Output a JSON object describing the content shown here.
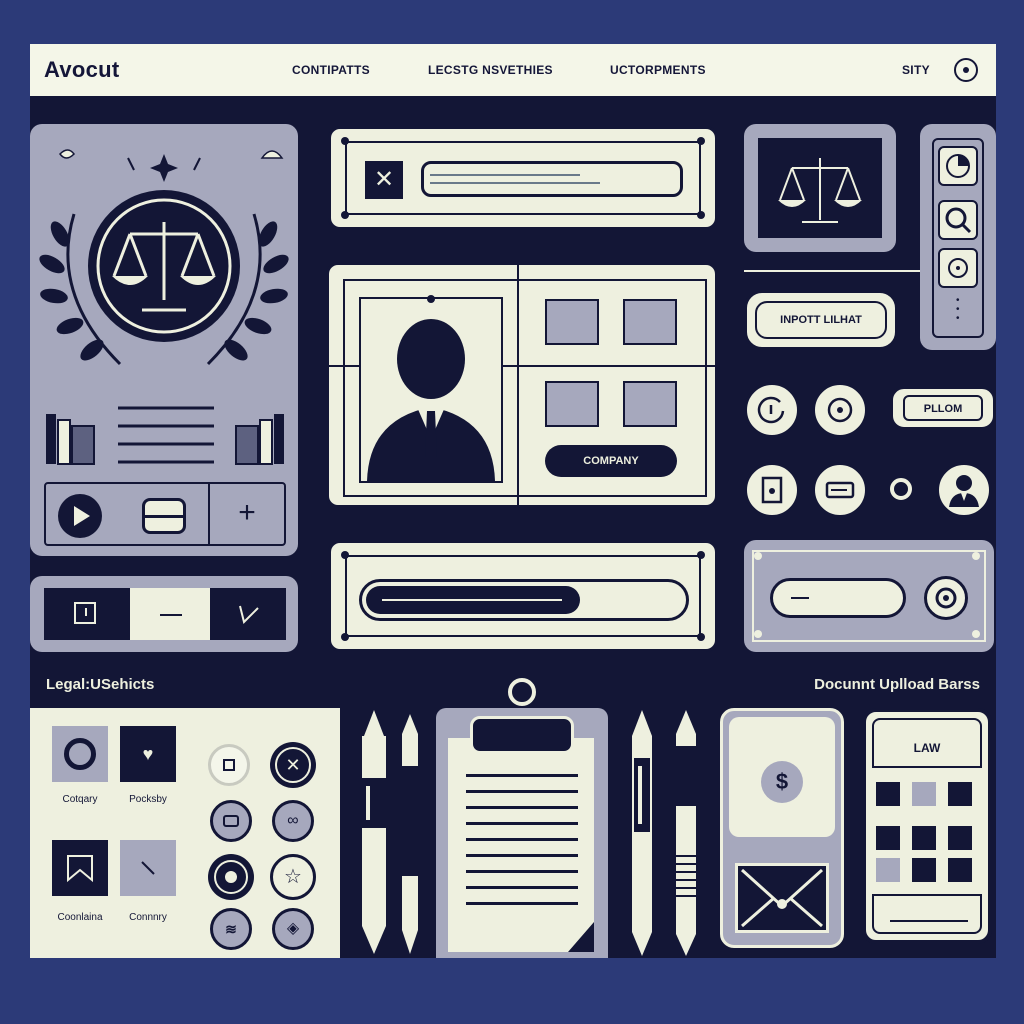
{
  "header": {
    "brand": "Avocut",
    "nav": [
      "CONTIPATTS",
      "LECSTG NSVETHIES",
      "UCTORPMENTS",
      "SITY"
    ],
    "menu_icon": "circle-dot-icon"
  },
  "panels": {
    "input_label": "INPOTT LILHAT",
    "company_button": "COMPANY",
    "plom_button": "PLLOM"
  },
  "sections": {
    "legal_title": "Legal:USehicts",
    "document_title": "Docunnt Uplload Barss"
  },
  "legal_tiles": [
    "Cotqary",
    "Pocksby",
    "Coonlaina",
    "Connnry"
  ],
  "phone": {
    "law_label": "LAW"
  },
  "colors": {
    "navy": "#131636",
    "cream": "#eef0df",
    "gray": "#a6a8bd",
    "background": "#2c3a78"
  }
}
